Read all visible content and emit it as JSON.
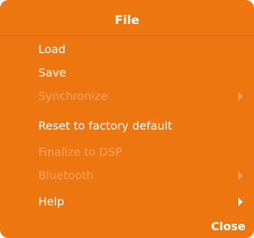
{
  "menu": {
    "title": "File",
    "items": [
      {
        "label": "Load",
        "enabled": true,
        "submenu": false
      },
      {
        "label": "Save",
        "enabled": true,
        "submenu": false
      },
      {
        "label": "Synchronize",
        "enabled": false,
        "submenu": true
      },
      {
        "label": "Reset to factory default",
        "enabled": true,
        "submenu": false
      },
      {
        "label": "Finalize to DSP",
        "enabled": false,
        "submenu": false
      },
      {
        "label": "Bluetooth",
        "enabled": false,
        "submenu": true
      },
      {
        "label": "Help",
        "enabled": true,
        "submenu": true
      }
    ],
    "close_label": "Close"
  },
  "colors": {
    "background": "#ee7610",
    "text": "#ffffff",
    "disabled_text": "#f7a467"
  },
  "icons": {
    "submenu_arrow": "chevron-right-icon"
  }
}
